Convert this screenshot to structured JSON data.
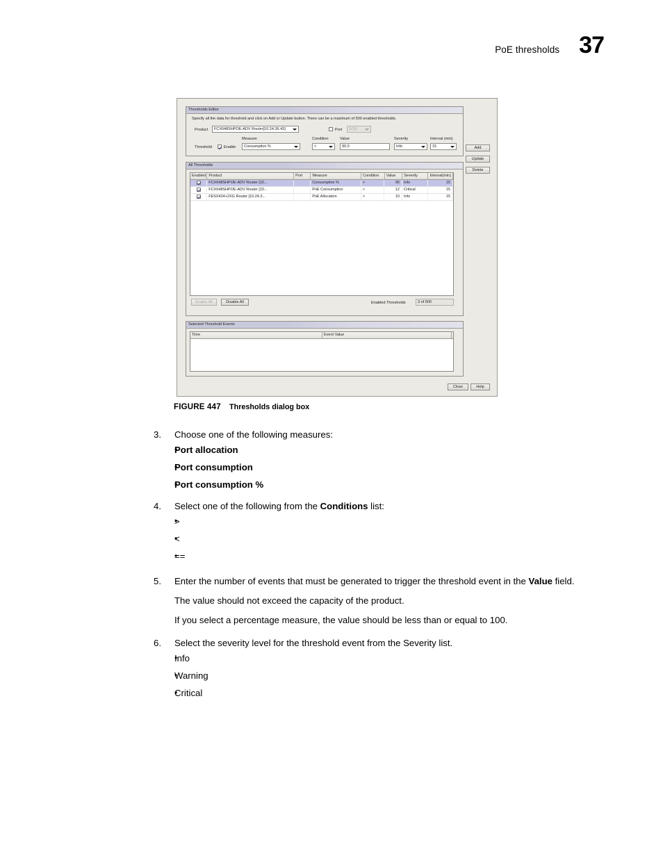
{
  "header": {
    "running_head": "PoE thresholds",
    "folio": "37"
  },
  "figure": {
    "caption_number": "FIGURE 447",
    "caption_title": "Thresholds dialog box",
    "dialog": {
      "editor_group_title": "Thresholds Editor",
      "hint": "Specify all the data for threshold and click on Add or Update button. There can be a maximum of 500 enabled thresholds.",
      "product_label": "Product",
      "product_value": "FCX648SHPOE-ADV Router[10.24.36.43]",
      "port_checkbox_label": "Port",
      "port_value": "1/1/1",
      "threshold_label": "Threshold",
      "enable_label": "Enable",
      "measure_label": "Measure",
      "measure_value": "Consumption %",
      "condition_label": "Condition",
      "condition_value": ">",
      "value_label": "Value",
      "value_value": "90.0",
      "severity_label": "Severity",
      "severity_value": "Info",
      "interval_label": "Interval (min)",
      "interval_value": "15",
      "add_button": "Add",
      "update_button": "Update",
      "delete_button": "Delete",
      "all_group_title": "All Thresholds",
      "table_headers": {
        "enabled": "Enabled",
        "product": "Product",
        "port": "Port",
        "measure": "Measure",
        "condition": "Condition",
        "value": "Value",
        "severity": "Severity",
        "interval": "Interval(min)"
      },
      "table_rows": [
        {
          "enabled": true,
          "product": "FCX648SHPOE-ADV Router [10...",
          "port": "",
          "measure": "Consumption %",
          "condition": ">",
          "value": "90",
          "severity": "Info",
          "interval": "15",
          "selected": true
        },
        {
          "enabled": true,
          "product": "FCX648SHPOE-ADV Router [10...",
          "port": "",
          "measure": "PoE Consumption",
          "condition": "<",
          "value": "12",
          "severity": "Critical",
          "interval": "15",
          "selected": false
        },
        {
          "enabled": true,
          "product": "FESX424+2XG Router [10.24.3...",
          "port": "",
          "measure": "PoE Allocation",
          "condition": ">",
          "value": "10",
          "severity": "Info",
          "interval": "15",
          "selected": false
        }
      ],
      "enable_all_button": "Enable All",
      "disable_all_button": "Disable All",
      "enabled_thresholds_label": "Enabled Thresholds",
      "enabled_thresholds_value": "3 of 500",
      "events_group_title": "Selected Threshold Events",
      "events_headers": {
        "time": "Time",
        "event_value": "Event Value"
      },
      "close_button": "Close",
      "help_button": "Help"
    }
  },
  "steps": {
    "step3": {
      "number": "3.",
      "text": "Choose one of the following measures:",
      "bullets": [
        "Port allocation",
        "Port consumption",
        "Port consumption %"
      ]
    },
    "step4": {
      "number": "4.",
      "text_before": "Select one of the following from the ",
      "text_bold": "Conditions",
      "text_after": " list:",
      "bullets": [
        ">",
        "<",
        "=="
      ]
    },
    "step5": {
      "number": "5.",
      "text_before": "Enter the number of events that must be generated to trigger the threshold event in the ",
      "text_bold": "Value",
      "text_after": " field.",
      "para1": "The value should not exceed the capacity of the product.",
      "para2": "If you select a percentage measure, the value should be less than or equal to 100."
    },
    "step6": {
      "number": "6.",
      "text": "Select the severity level for the threshold event from the Severity list.",
      "bullets": [
        "Info",
        "Warning",
        "Critical"
      ]
    }
  }
}
